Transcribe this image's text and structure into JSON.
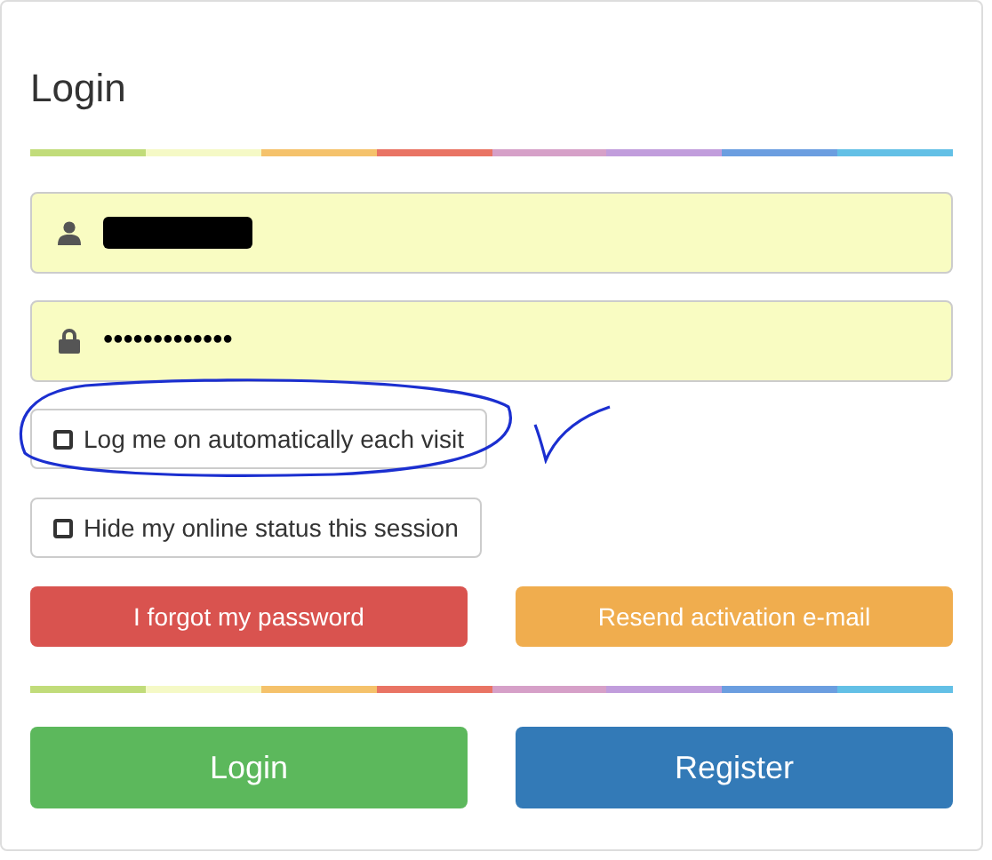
{
  "title": "Login",
  "stripe": [
    {
      "color": "#c1dc7a"
    },
    {
      "color": "#f5f9c6"
    },
    {
      "color": "#f5c26b"
    },
    {
      "color": "#e97464"
    },
    {
      "color": "#d6a0c8"
    },
    {
      "color": "#c19ddc"
    },
    {
      "color": "#6b9ee0"
    },
    {
      "color": "#63c0e6"
    }
  ],
  "username": {
    "redacted": true
  },
  "password": {
    "value": "•••••••••••••"
  },
  "options": [
    {
      "label": "Log me on automatically each visit",
      "checked": false
    },
    {
      "label": "Hide my online status this session",
      "checked": false
    }
  ],
  "links": [
    {
      "label": "I forgot my password",
      "color": "#d9534f"
    },
    {
      "label": "Resend activation e-mail",
      "color": "#f0ad4e"
    }
  ],
  "actions": [
    {
      "label": "Login",
      "color": "#5cb85c"
    },
    {
      "label": "Register",
      "color": "#337ab7"
    }
  ],
  "annotations": [
    {
      "kind": "ellipse"
    },
    {
      "kind": "checkmark"
    }
  ]
}
